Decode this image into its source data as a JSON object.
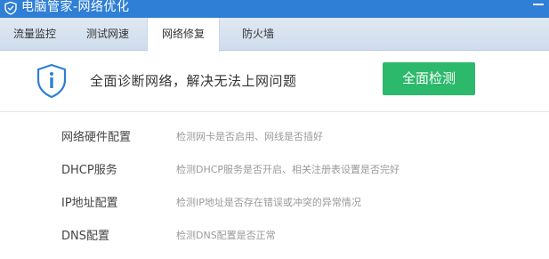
{
  "window": {
    "title": "电脑管家-网络优化"
  },
  "tabs": [
    {
      "label": "流量监控",
      "active": false
    },
    {
      "label": "测试网速",
      "active": false
    },
    {
      "label": "网络修复",
      "active": true
    },
    {
      "label": "防火墙",
      "active": false
    }
  ],
  "header": {
    "icon": "info-shield-icon",
    "headline": "全面诊断网络，解决无法上网问题",
    "scan_button": "全面检测"
  },
  "checks": [
    {
      "name": "网络硬件配置",
      "desc": "检测网卡是否启用、网线是否插好"
    },
    {
      "name": "DHCP服务",
      "desc": "检测DHCP服务是否开启、相关注册表设置是否完好"
    },
    {
      "name": "IP地址配置",
      "desc": "检测IP地址是否存在错误或冲突的异常情况"
    },
    {
      "name": "DNS配置",
      "desc": "检测DNS配置是否正常"
    }
  ],
  "colors": {
    "titlebar": "#2f7fd6",
    "scan_button": "#2cb96b",
    "icon_blue": "#2f7fd6"
  }
}
